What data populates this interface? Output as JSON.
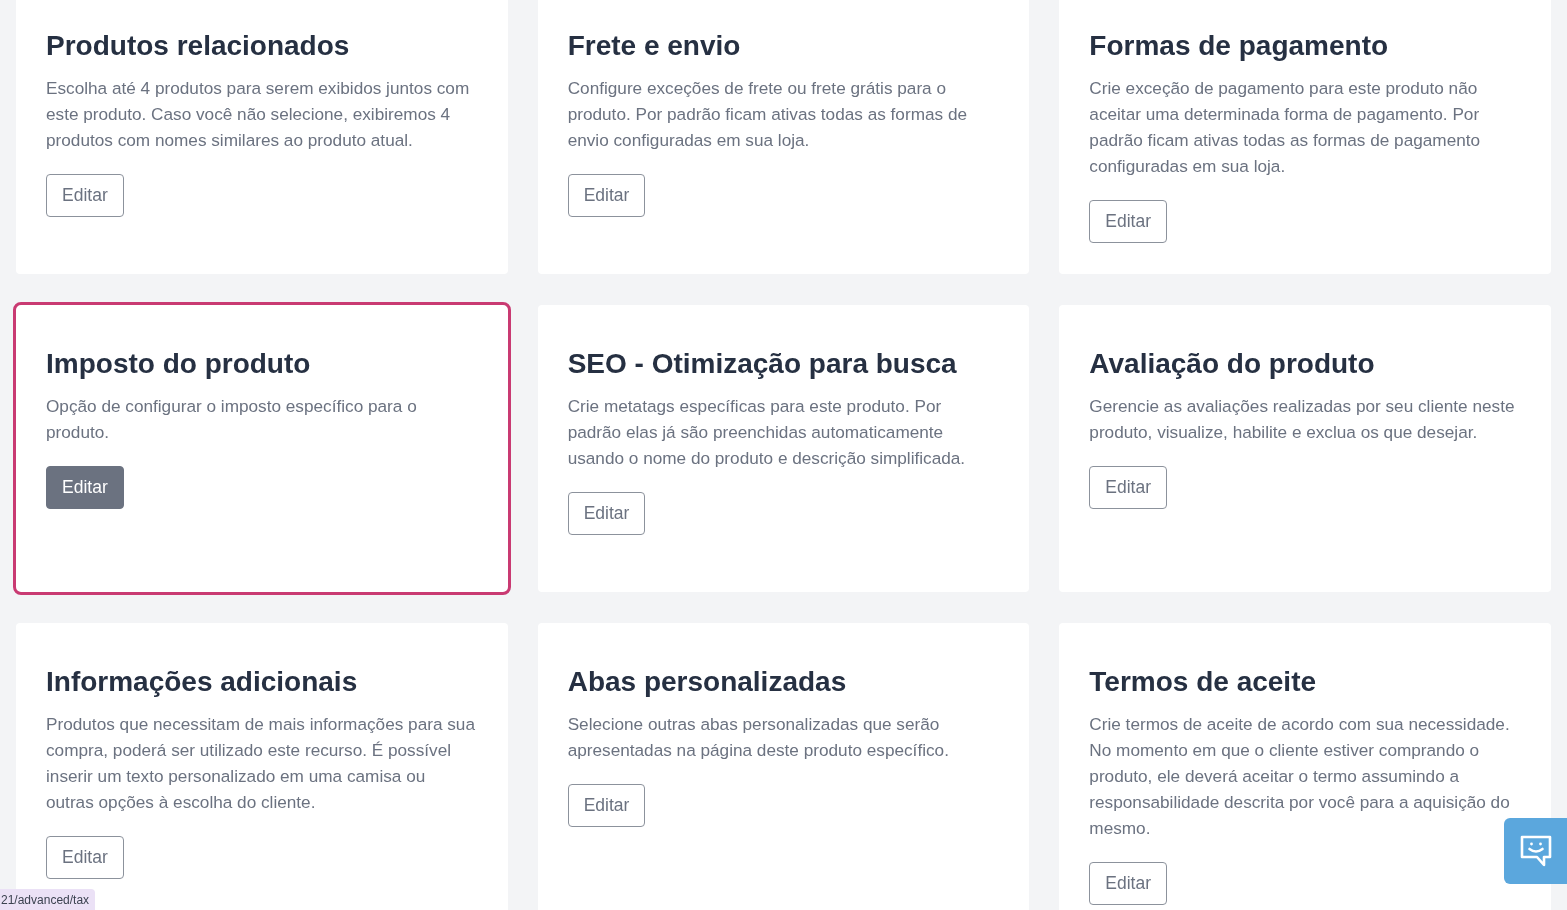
{
  "cards": [
    {
      "title": "Produtos relacionados",
      "description": "Escolha até 4 produtos para serem exibidos juntos com este produto. Caso você não selecione, exibiremos 4 produtos com nomes similares ao produto atual.",
      "highlighted": false,
      "button": {
        "label": "Editar",
        "hovered": false
      }
    },
    {
      "title": "Frete e envio",
      "description": "Configure exceções de frete ou frete grátis para o produto. Por padrão ficam ativas todas as formas de envio configuradas em sua loja.",
      "highlighted": false,
      "button": {
        "label": "Editar",
        "hovered": false
      }
    },
    {
      "title": "Formas de pagamento",
      "description": "Crie exceção de pagamento para este produto não aceitar uma determinada forma de pagamento. Por padrão ficam ativas todas as formas de pagamento configuradas em sua loja.",
      "highlighted": false,
      "button": {
        "label": "Editar",
        "hovered": false
      }
    },
    {
      "title": "Imposto do produto",
      "description": "Opção de configurar o imposto específico para o produto.",
      "highlighted": true,
      "button": {
        "label": "Editar",
        "hovered": true
      }
    },
    {
      "title": "SEO - Otimização para busca",
      "description": "Crie metatags específicas para este produto. Por padrão elas já são preenchidas automaticamente usando o nome do produto e descrição simplificada.",
      "highlighted": false,
      "button": {
        "label": "Editar",
        "hovered": false
      }
    },
    {
      "title": "Avaliação do produto",
      "description": "Gerencie as avaliações realizadas por seu cliente neste produto, visualize, habilite e exclua os que desejar.",
      "highlighted": false,
      "button": {
        "label": "Editar",
        "hovered": false
      }
    },
    {
      "title": "Informações adicionais",
      "description": "Produtos que necessitam de mais informações para sua compra, poderá ser utilizado este recurso. É possível inserir um texto personalizado em uma camisa ou outras opções à escolha do cliente.",
      "highlighted": false,
      "button": {
        "label": "Editar",
        "hovered": false
      }
    },
    {
      "title": "Abas personalizadas",
      "description": "Selecione outras abas personalizadas que serão apresentadas na página deste produto específico.",
      "highlighted": false,
      "button": {
        "label": "Editar",
        "hovered": false
      }
    },
    {
      "title": "Termos de aceite",
      "description": "Crie termos de aceite de acordo com sua necessidade. No momento em que o cliente estiver comprando o produto, ele deverá aceitar o termo assumindo a responsabilidade descrita por você para a aquisição do mesmo.",
      "highlighted": false,
      "button": {
        "label": "Editar",
        "hovered": false
      }
    }
  ],
  "status_url": "21/advanced/tax"
}
